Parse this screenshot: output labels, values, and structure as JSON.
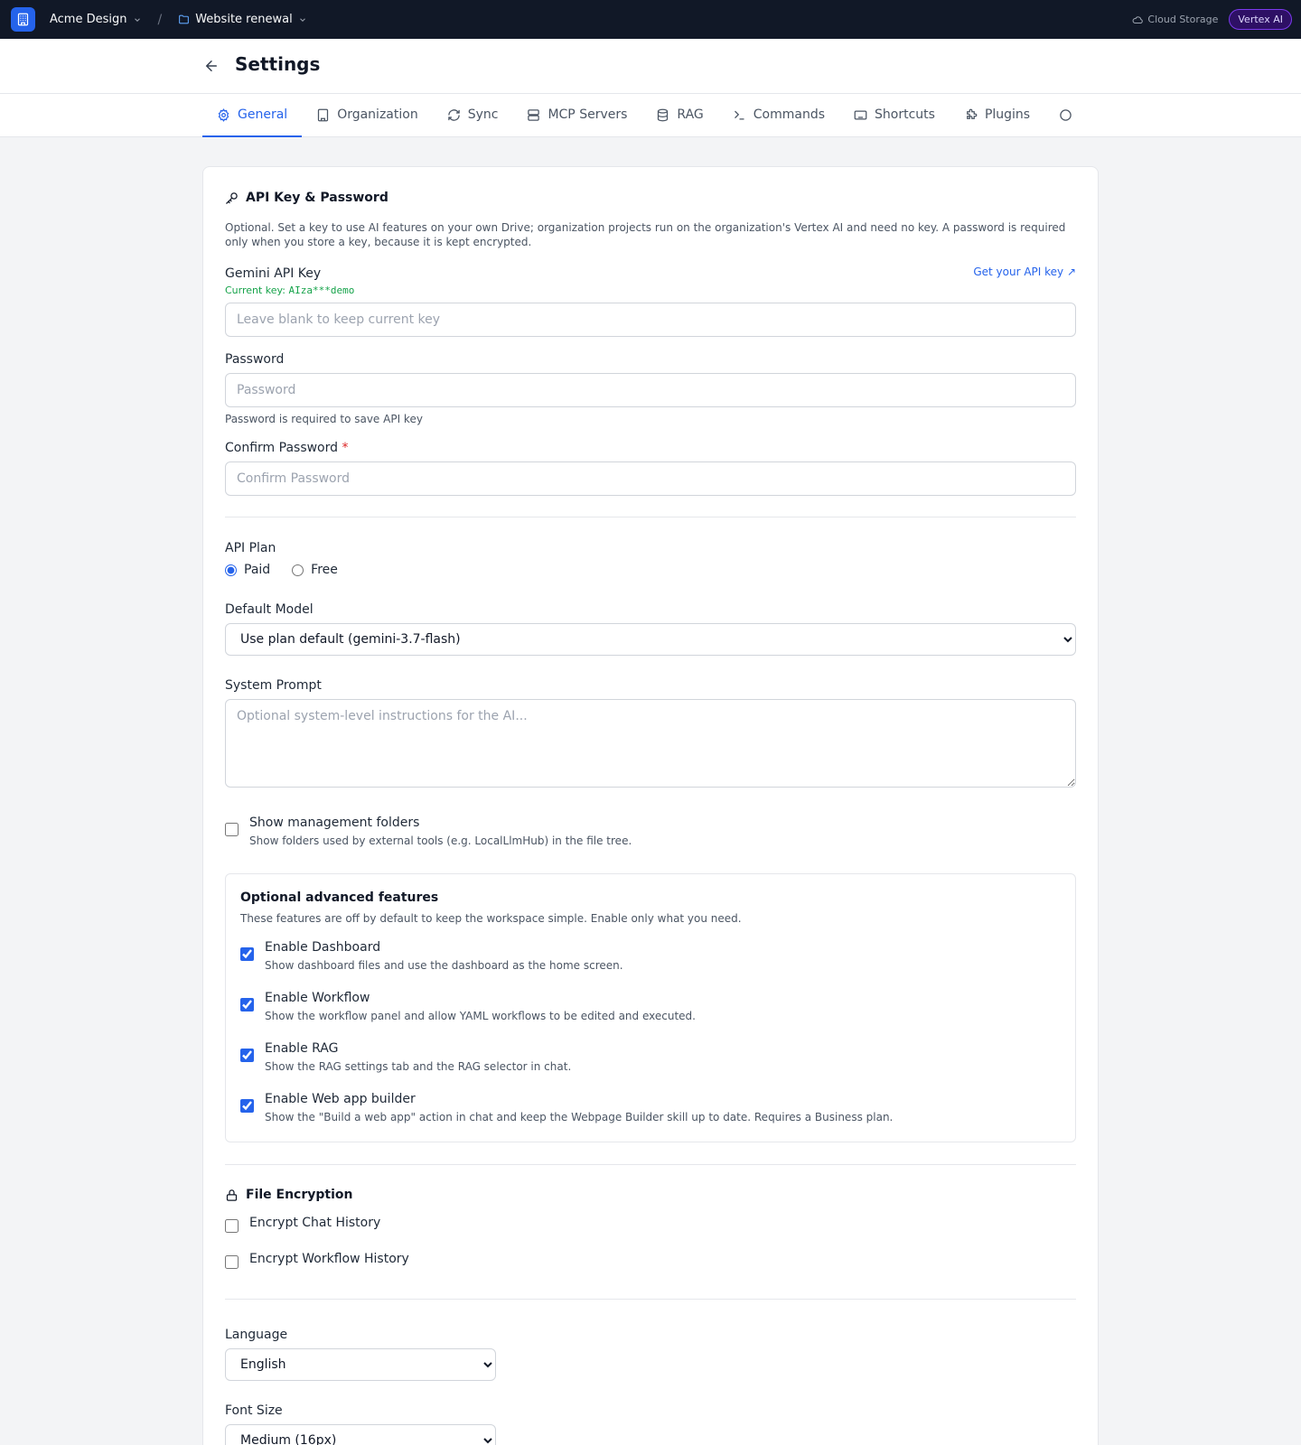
{
  "topbar": {
    "workspace": "Acme Design",
    "separator": "/",
    "project": "Website renewal",
    "storage": "Cloud Storage",
    "badge": "Vertex AI"
  },
  "header": {
    "title": "Settings"
  },
  "tabs": [
    {
      "label": "General",
      "icon": "gear-icon",
      "active": true
    },
    {
      "label": "Organization",
      "icon": "building-icon"
    },
    {
      "label": "Sync",
      "icon": "refresh-icon"
    },
    {
      "label": "MCP Servers",
      "icon": "server-icon"
    },
    {
      "label": "RAG",
      "icon": "database-icon"
    },
    {
      "label": "Commands",
      "icon": "terminal-icon"
    },
    {
      "label": "Shortcuts",
      "icon": "keyboard-icon"
    },
    {
      "label": "Plugins",
      "icon": "puzzle-icon"
    }
  ],
  "api": {
    "title": "API Key & Password",
    "description": "Optional. Set a key to use AI features on your own Drive; organization projects run on the organization's Vertex AI and need no key. A password is required only when you store a key, because it is kept encrypted.",
    "key_label": "Gemini API Key",
    "get_key_link": "Get your API key ↗",
    "current_key_prefix": "Current key:",
    "current_key_value": "AIza***demo",
    "key_placeholder": "Leave blank to keep current key",
    "password_label": "Password",
    "password_placeholder": "Password",
    "password_hint": "Password is required to save API key",
    "confirm_label": "Confirm Password",
    "confirm_required": "*",
    "confirm_placeholder": "Confirm Password"
  },
  "plan": {
    "label": "API Plan",
    "options": [
      "Paid",
      "Free"
    ],
    "selected": "Paid"
  },
  "model": {
    "label": "Default Model",
    "selected": "Use plan default (gemini-3.7-flash)"
  },
  "system_prompt": {
    "label": "System Prompt",
    "placeholder": "Optional system-level instructions for the AI..."
  },
  "management": {
    "title": "Show management folders",
    "description": "Show folders used by external tools (e.g. LocalLlmHub) in the file tree.",
    "checked": false
  },
  "advanced": {
    "title": "Optional advanced features",
    "description": "These features are off by default to keep the workspace simple. Enable only what you need.",
    "items": [
      {
        "title": "Enable Dashboard",
        "description": "Show dashboard files and use the dashboard as the home screen.",
        "checked": true
      },
      {
        "title": "Enable Workflow",
        "description": "Show the workflow panel and allow YAML workflows to be edited and executed.",
        "checked": true
      },
      {
        "title": "Enable RAG",
        "description": "Show the RAG settings tab and the RAG selector in chat.",
        "checked": true
      },
      {
        "title": "Enable Web app builder",
        "description": "Show the \"Build a web app\" action in chat and keep the Webpage Builder skill up to date. Requires a Business plan.",
        "checked": true
      }
    ]
  },
  "encryption": {
    "title": "File Encryption",
    "chat_label": "Encrypt Chat History",
    "workflow_label": "Encrypt Workflow History"
  },
  "language": {
    "label": "Language",
    "selected": "English"
  },
  "font_size": {
    "label": "Font Size",
    "selected": "Medium (16px)"
  },
  "colors": {
    "accent": "#2563eb",
    "topbar": "#111827",
    "success": "#16a34a",
    "danger": "#dc2626"
  }
}
